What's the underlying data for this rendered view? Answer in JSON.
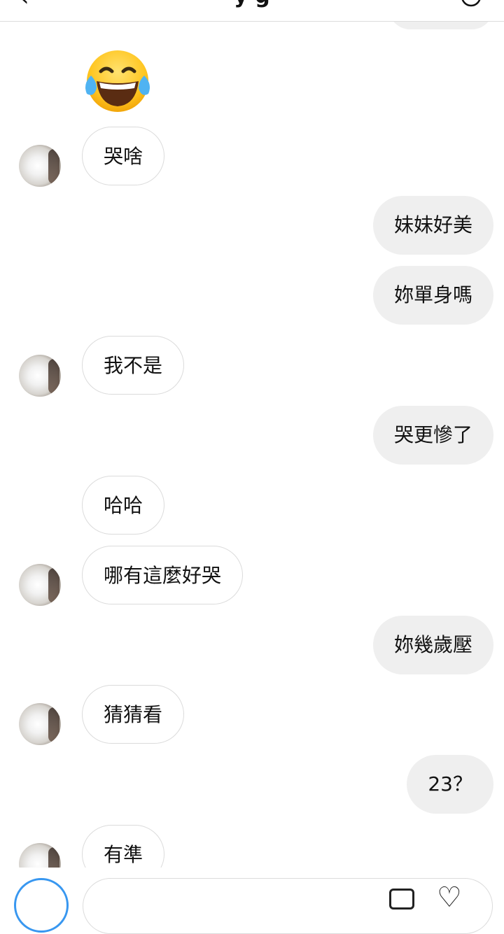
{
  "header": {
    "back_icon": "chevron-left-icon",
    "title": "y g",
    "info_icon": "info-icon"
  },
  "messages": [
    {
      "side": "in",
      "type": "emoji",
      "emoji": "face-with-tears-of-joy"
    },
    {
      "side": "in",
      "text": "哭啥",
      "avatar": true
    },
    {
      "side": "out",
      "text": "妹妹好美"
    },
    {
      "side": "out",
      "text": "妳單身嗎"
    },
    {
      "side": "in",
      "text": "我不是",
      "avatar": true
    },
    {
      "side": "out",
      "text": "哭更慘了"
    },
    {
      "side": "in",
      "text": "哈哈"
    },
    {
      "side": "in",
      "text": "哪有這麼好哭",
      "avatar": true
    },
    {
      "side": "out",
      "text": "妳幾歲壓"
    },
    {
      "side": "in",
      "text": "猜猜看",
      "avatar": true
    },
    {
      "side": "out",
      "text": "23？"
    },
    {
      "side": "in",
      "text": "有準",
      "avatar": true
    }
  ],
  "composer": {
    "camera_icon": "camera-icon",
    "gallery_icon": "gallery-icon",
    "heart_icon": "heart-icon"
  },
  "colors": {
    "outgoing_bubble": "#efefef",
    "incoming_border": "#dbdbdb",
    "accent": "#3897f0"
  }
}
